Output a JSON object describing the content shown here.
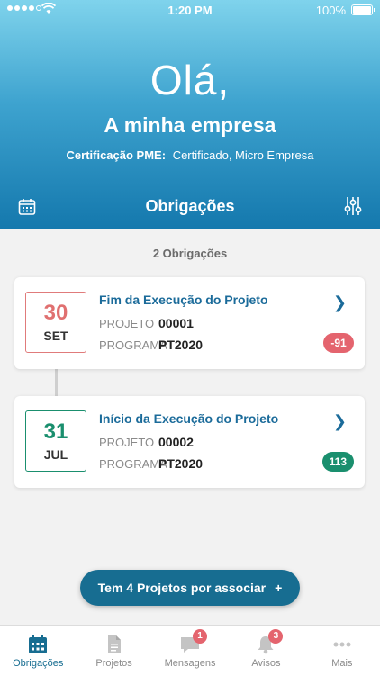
{
  "status_bar": {
    "time": "1:20 PM",
    "battery": "100%"
  },
  "header": {
    "greeting": "Olá,",
    "company": "A minha empresa",
    "cert_label": "Certificação PME:",
    "cert_value": "Certificado, Micro Empresa",
    "section_title": "Obrigações"
  },
  "list": {
    "count_label": "2 Obrigações",
    "items": [
      {
        "day": "30",
        "month": "SET",
        "title": "Fim da Execução do Projeto",
        "projeto_label": "PROJETO",
        "projeto": "00001",
        "programa_label": "PROGRAMA",
        "programa": "PT2020",
        "badge": "-91",
        "color": "#e4646e"
      },
      {
        "day": "31",
        "month": "JUL",
        "title": "Início da Execução do Projeto",
        "projeto_label": "PROJETO",
        "projeto": "00002",
        "programa_label": "PROGRAMA",
        "programa": "PT2020",
        "badge": "113",
        "color": "#1a8f6e"
      }
    ]
  },
  "assoc_button": {
    "label": "Tem 4 Projetos por associar",
    "plus": "+"
  },
  "tabbar": {
    "items": [
      {
        "label": "Obrigações",
        "icon": "calendar-icon",
        "active": true
      },
      {
        "label": "Projetos",
        "icon": "document-icon"
      },
      {
        "label": "Mensagens",
        "icon": "chat-icon",
        "badge": "1"
      },
      {
        "label": "Avisos",
        "icon": "bell-icon",
        "badge": "3"
      },
      {
        "label": "Mais",
        "icon": "more-icon"
      }
    ]
  },
  "colors": {
    "accent": "#176d91",
    "negative": "#e4646e",
    "positive": "#1a8f6e"
  }
}
